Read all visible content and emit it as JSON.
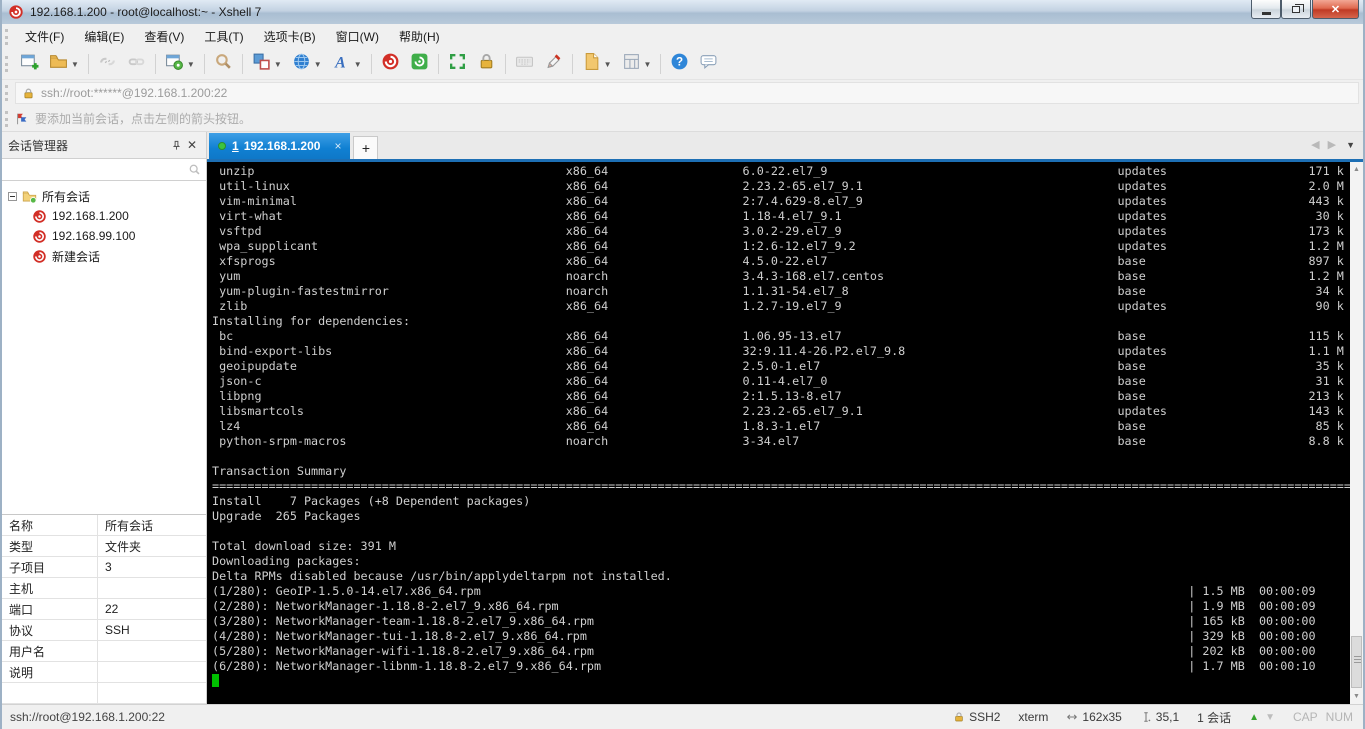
{
  "colors": {
    "tab_active_blue": "#1080d2",
    "terminal_background": "#000000",
    "terminal_text": "#cfcfcf",
    "cursor_green": "#00c000",
    "xshell_red": "#d22f27",
    "xftp_green": "#3fae49"
  },
  "window": {
    "title": "192.168.1.200 - root@localhost:~ - Xshell 7"
  },
  "menu": {
    "items": [
      "文件(F)",
      "编辑(E)",
      "查看(V)",
      "工具(T)",
      "选项卡(B)",
      "窗口(W)",
      "帮助(H)"
    ]
  },
  "toolbar": {
    "items": [
      {
        "name": "new-session"
      },
      {
        "name": "open-folder",
        "dropdown": true
      },
      {
        "sep": true
      },
      {
        "name": "disconnect",
        "disabled": true
      },
      {
        "name": "reconnect",
        "disabled": true
      },
      {
        "sep": true
      },
      {
        "name": "session-properties",
        "dropdown": true
      },
      {
        "sep": true
      },
      {
        "name": "find"
      },
      {
        "sep": true
      },
      {
        "name": "compose-pane",
        "dropdown": true
      },
      {
        "name": "web-browser",
        "dropdown": true
      },
      {
        "name": "font",
        "dropdown": true
      },
      {
        "sep": true
      },
      {
        "name": "xshell"
      },
      {
        "name": "xftp"
      },
      {
        "sep": true
      },
      {
        "name": "fullscreen"
      },
      {
        "name": "lock-screen"
      },
      {
        "sep": true
      },
      {
        "name": "virtual-keyboard",
        "disabled": true
      },
      {
        "name": "highlight-pen"
      },
      {
        "sep": true
      },
      {
        "name": "new-file",
        "dropdown": true
      },
      {
        "name": "layout",
        "dropdown": true
      },
      {
        "sep": true
      },
      {
        "name": "help"
      },
      {
        "name": "feedback"
      }
    ]
  },
  "address_bar": {
    "url": "ssh://root:******@192.168.1.200:22"
  },
  "notice_bar": {
    "text": "要添加当前会话，点击左侧的箭头按钮。"
  },
  "session_manager": {
    "title": "会话管理器",
    "tree": {
      "root_label": "所有会话",
      "sessions": [
        "192.168.1.200",
        "192.168.99.100",
        "新建会话"
      ]
    },
    "properties": [
      {
        "label": "名称",
        "value": "所有会话"
      },
      {
        "label": "类型",
        "value": "文件夹"
      },
      {
        "label": "子项目",
        "value": "3"
      },
      {
        "label": "主机",
        "value": ""
      },
      {
        "label": "端口",
        "value": "22"
      },
      {
        "label": "协议",
        "value": "SSH"
      },
      {
        "label": "用户名",
        "value": ""
      },
      {
        "label": "说明",
        "value": ""
      }
    ]
  },
  "tab_bar": {
    "active_tab": {
      "number": "1",
      "host": "192.168.1.200",
      "close_label": "×"
    },
    "new_tab_label": "+"
  },
  "terminal": {
    "package_rows": [
      [
        "unzip",
        "x86_64",
        "6.0-22.el7_9",
        "updates",
        "171 k"
      ],
      [
        "util-linux",
        "x86_64",
        "2.23.2-65.el7_9.1",
        "updates",
        "2.0 M"
      ],
      [
        "vim-minimal",
        "x86_64",
        "2:7.4.629-8.el7_9",
        "updates",
        "443 k"
      ],
      [
        "virt-what",
        "x86_64",
        "1.18-4.el7_9.1",
        "updates",
        "30 k"
      ],
      [
        "vsftpd",
        "x86_64",
        "3.0.2-29.el7_9",
        "updates",
        "173 k"
      ],
      [
        "wpa_supplicant",
        "x86_64",
        "1:2.6-12.el7_9.2",
        "updates",
        "1.2 M"
      ],
      [
        "xfsprogs",
        "x86_64",
        "4.5.0-22.el7",
        "base",
        "897 k"
      ],
      [
        "yum",
        "noarch",
        "3.4.3-168.el7.centos",
        "base",
        "1.2 M"
      ],
      [
        "yum-plugin-fastestmirror",
        "noarch",
        "1.1.31-54.el7_8",
        "base",
        "34 k"
      ],
      [
        "zlib",
        "x86_64",
        "1.2.7-19.el7_9",
        "updates",
        "90 k"
      ]
    ],
    "dependencies_header": "Installing for dependencies:",
    "dependency_rows": [
      [
        "bc",
        "x86_64",
        "1.06.95-13.el7",
        "base",
        "115 k"
      ],
      [
        "bind-export-libs",
        "x86_64",
        "32:9.11.4-26.P2.el7_9.8",
        "updates",
        "1.1 M"
      ],
      [
        "geoipupdate",
        "x86_64",
        "2.5.0-1.el7",
        "base",
        "35 k"
      ],
      [
        "json-c",
        "x86_64",
        "0.11-4.el7_0",
        "base",
        "31 k"
      ],
      [
        "libpng",
        "x86_64",
        "2:1.5.13-8.el7",
        "base",
        "213 k"
      ],
      [
        "libsmartcols",
        "x86_64",
        "2.23.2-65.el7_9.1",
        "updates",
        "143 k"
      ],
      [
        "lz4",
        "x86_64",
        "1.8.3-1.el7",
        "base",
        "85 k"
      ],
      [
        "python-srpm-macros",
        "noarch",
        "3-34.el7",
        "base",
        "8.8 k"
      ]
    ],
    "separator": {
      "char": "=",
      "count": 161
    },
    "transaction_lines": [
      "",
      "Transaction Summary",
      "@SEPARATOR@",
      "Install    7 Packages (+8 Dependent packages)",
      "Upgrade  265 Packages",
      "",
      "Total download size: 391 M",
      "Downloading packages:",
      "Delta RPMs disabled because /usr/bin/applydeltarpm not installed."
    ],
    "download_rows": [
      [
        "(1/280):",
        "GeoIP-1.5.0-14.el7.x86_64.rpm",
        "1.5 MB",
        "00:00:09"
      ],
      [
        "(2/280):",
        "NetworkManager-1.18.8-2.el7_9.x86_64.rpm",
        "1.9 MB",
        "00:00:09"
      ],
      [
        "(3/280):",
        "NetworkManager-team-1.18.8-2.el7_9.x86_64.rpm",
        "165 kB",
        "00:00:00"
      ],
      [
        "(4/280):",
        "NetworkManager-tui-1.18.8-2.el7_9.x86_64.rpm",
        "329 kB",
        "00:00:00"
      ],
      [
        "(5/280):",
        "NetworkManager-wifi-1.18.8-2.el7_9.x86_64.rpm",
        "202 kB",
        "00:00:00"
      ],
      [
        "(6/280):",
        "NetworkManager-libnm-1.18.8-2.el7_9.x86_64.rpm",
        "1.7 MB",
        "00:00:10"
      ]
    ]
  },
  "status_bar": {
    "left": "ssh://root@192.168.1.200:22",
    "protocol": "SSH2",
    "terminal_type": "xterm",
    "terminal_size": "162x35",
    "cursor_position": "35,1",
    "session_count": "1 会话",
    "caps_label": "CAP",
    "num_label": "NUM"
  }
}
